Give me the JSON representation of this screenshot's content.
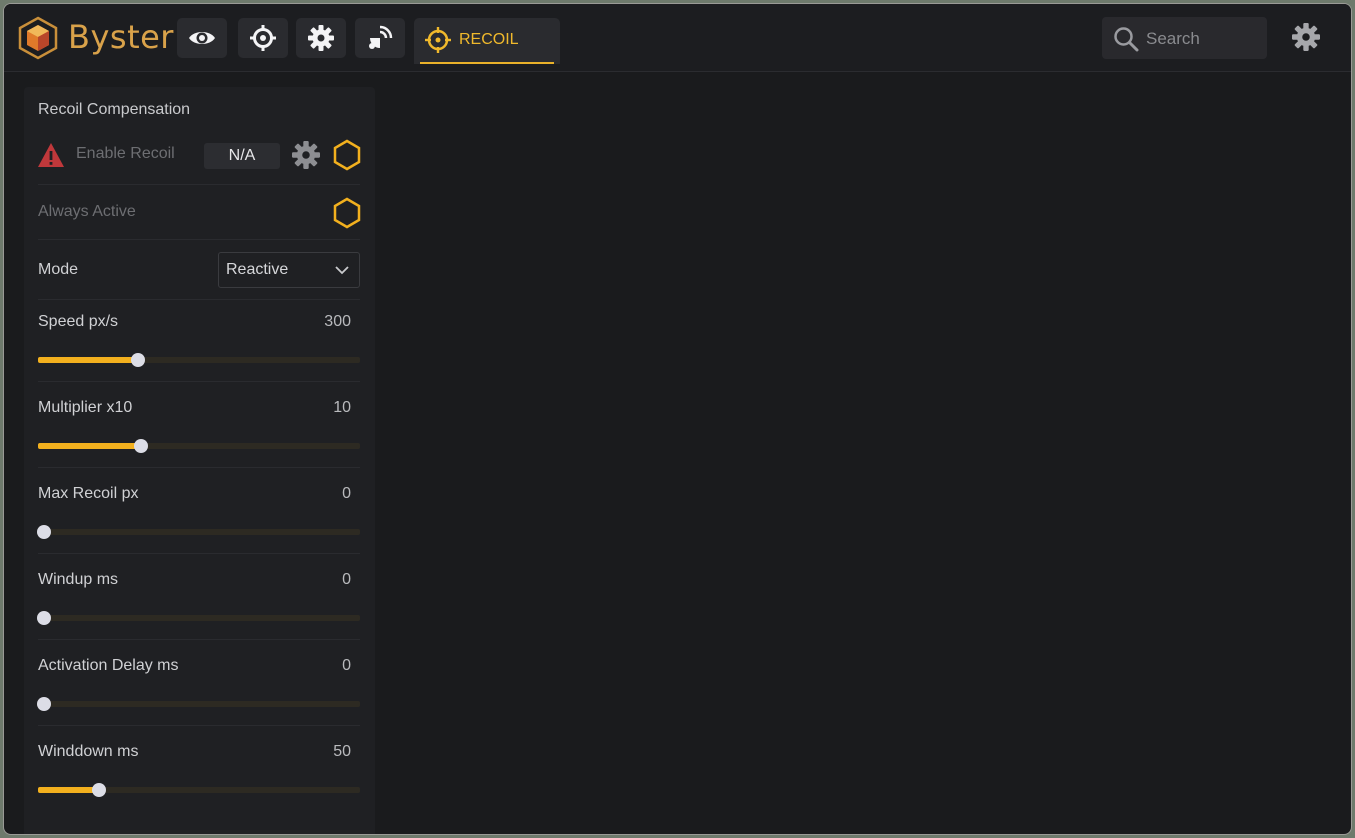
{
  "app": {
    "brand": "Byster",
    "colors": {
      "accent": "#f2b01e",
      "brand": "#d9a24a",
      "background": "#1a1b1d",
      "panel": "#1f2023"
    }
  },
  "nav": {
    "buttons": [
      {
        "icon": "eye-icon"
      },
      {
        "icon": "crosshair-icon"
      },
      {
        "icon": "gear-icon"
      },
      {
        "icon": "radar-icon"
      }
    ],
    "active_tab": {
      "icon": "target-icon",
      "label": "RECOIL"
    }
  },
  "search": {
    "placeholder": "Search",
    "icon": "search-icon"
  },
  "settings": {
    "icon": "gear-icon"
  },
  "panel": {
    "title": "Recoil Compensation",
    "enable": {
      "label": "Enable Recoil",
      "status": "N/A",
      "warning_icon": "warning-icon",
      "toggle_icon": "hexagon-icon"
    },
    "always_active": {
      "label": "Always Active",
      "toggle_icon": "hexagon-icon"
    },
    "mode": {
      "label": "Mode",
      "value": "Reactive"
    },
    "sliders": [
      {
        "label": "Speed px/s",
        "value": "300",
        "fill": 0.31
      },
      {
        "label": "Multiplier x10",
        "value": "10",
        "fill": 0.32
      },
      {
        "label": "Max Recoil px",
        "value": "0",
        "fill": 0.02
      },
      {
        "label": "Windup ms",
        "value": "0",
        "fill": 0.02
      },
      {
        "label": "Activation Delay ms",
        "value": "0",
        "fill": 0.02
      },
      {
        "label": "Winddown ms",
        "value": "50",
        "fill": 0.19
      }
    ]
  }
}
